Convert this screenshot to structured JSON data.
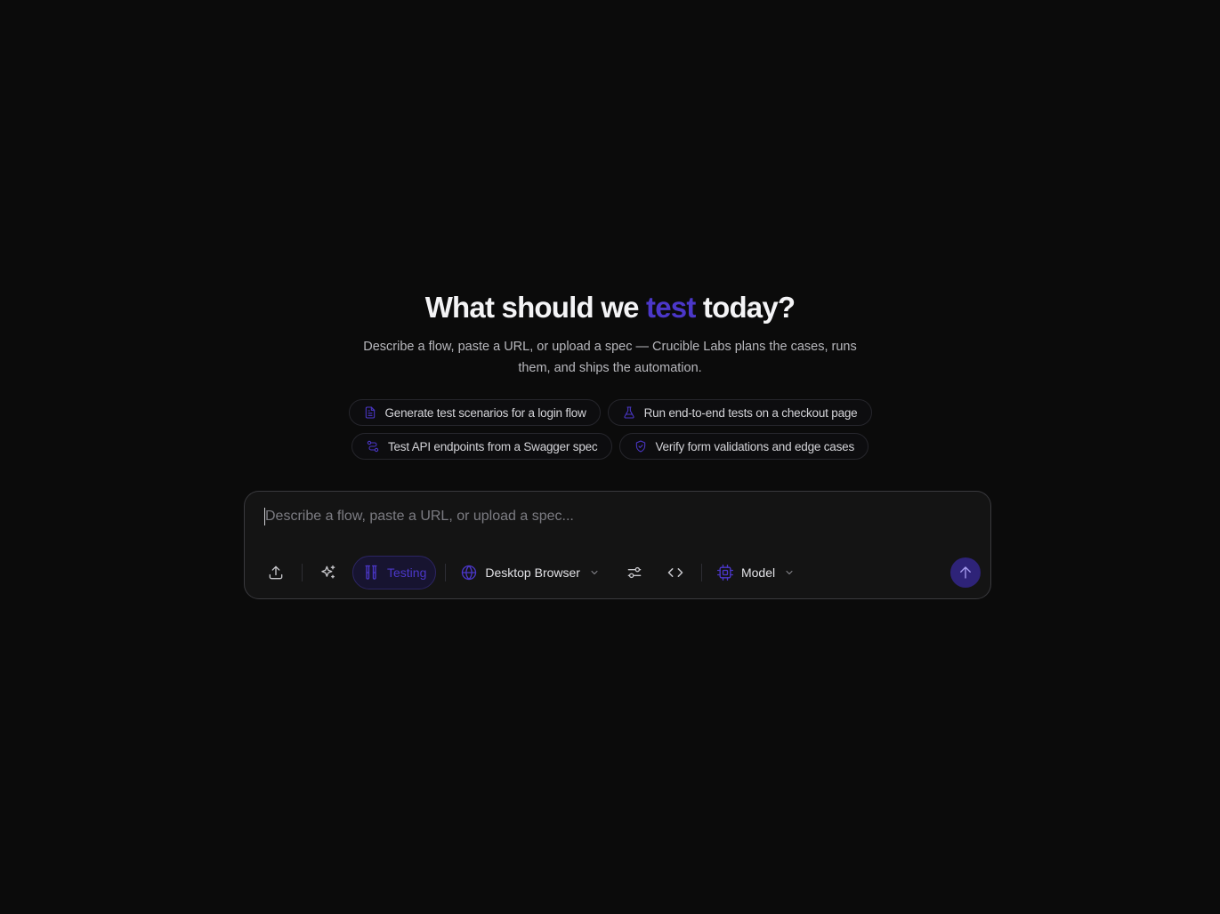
{
  "hero": {
    "title_before": "What should we ",
    "title_accent": "test",
    "title_after": " today?",
    "subtitle": "Describe a flow, paste a URL, or upload a spec — Crucible Labs plans the cases, runs them, and ships the automation."
  },
  "suggestions": [
    {
      "label": "Generate test scenarios for a login flow",
      "icon": "document-icon"
    },
    {
      "label": "Run end-to-end tests on a checkout page",
      "icon": "flask-icon"
    },
    {
      "label": "Test API endpoints from a Swagger spec",
      "icon": "route-icon"
    },
    {
      "label": "Verify form validations and edge cases",
      "icon": "shield-check-icon"
    }
  ],
  "composer": {
    "placeholder": "Describe a flow, paste a URL, or upload a spec...",
    "mode_label": "Testing",
    "environment_label": "Desktop Browser",
    "model_label": "Model"
  },
  "colors": {
    "background": "#0b0b0b",
    "accent": "#4b37c9",
    "send_button": "#2e2378"
  }
}
